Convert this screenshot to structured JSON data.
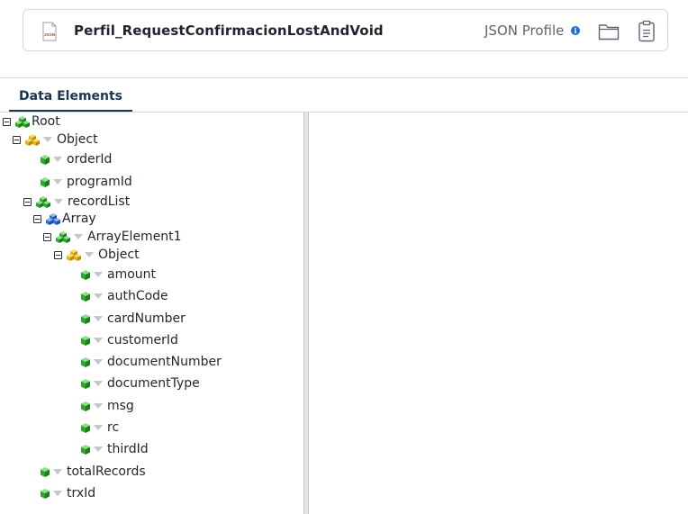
{
  "header": {
    "file_icon": "json-file-icon",
    "file_icon_text": "JSON",
    "profile_name": "Perfil_RequestConfirmacionLostAndVoid",
    "profile_type": "JSON Profile",
    "info_icon_text": "i",
    "actions": [
      "folder-icon",
      "clipboard-icon"
    ]
  },
  "tabs": {
    "data_elements": "Data Elements"
  },
  "tree": {
    "root": "Root",
    "object": "Object",
    "orderId": "orderId",
    "programId": "programId",
    "recordList": "recordList",
    "array": "Array",
    "arrayElement1": "ArrayElement1",
    "inner_object": "Object",
    "amount": "amount",
    "authCode": "authCode",
    "cardNumber": "cardNumber",
    "customerId": "customerId",
    "documentNumber": "documentNumber",
    "documentType": "documentType",
    "msg": "msg",
    "rc": "rc",
    "thirdId": "thirdId",
    "totalRecords": "totalRecords",
    "trxId": "trxId"
  },
  "colors": {
    "tab_accent": "#1b3553",
    "element_cube": "#2ea62e",
    "object_cubes": "#e3b21a",
    "array_cubes": "#2e6fd6",
    "info": "#1a6fd0"
  }
}
